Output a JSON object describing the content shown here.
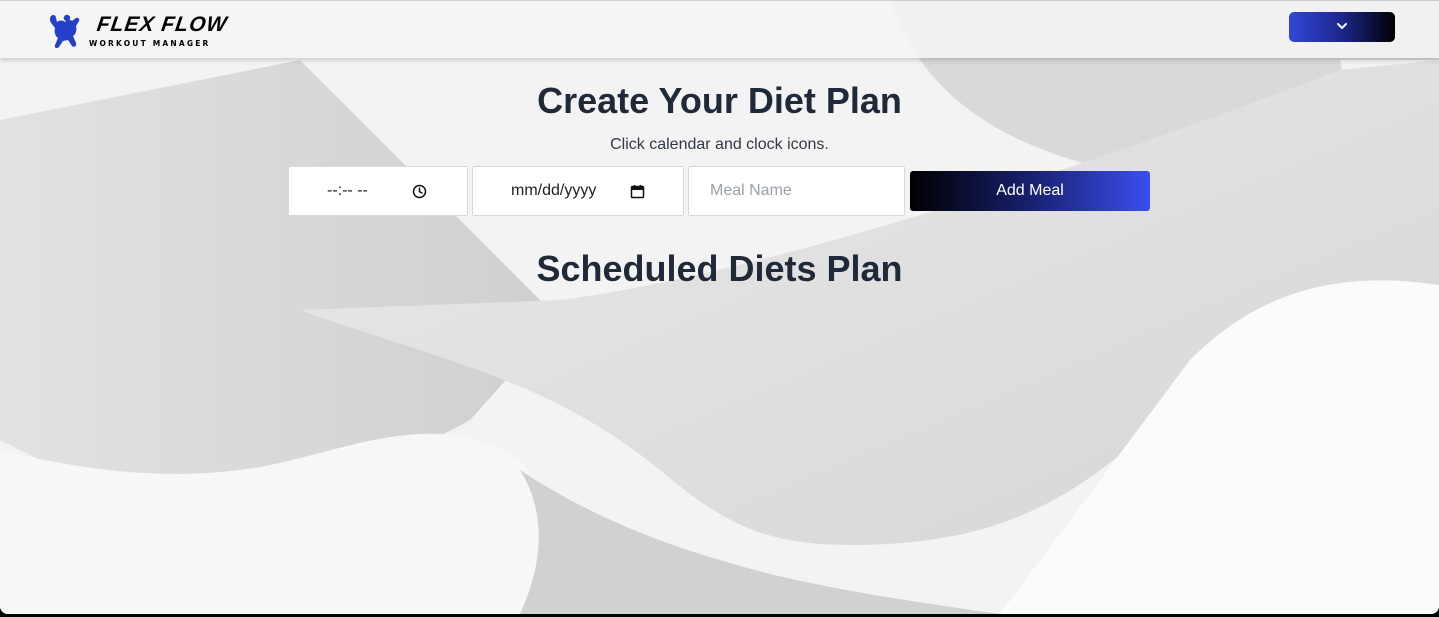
{
  "navbar": {
    "logo_title": "FLEX FLOW",
    "logo_subtitle": "WORKOUT MANAGER",
    "logo_icon": "bodybuilder-icon",
    "menu_icon": "chevron-down-icon"
  },
  "form": {
    "title": "Create Your Diet Plan",
    "hint": "Click calendar and clock icons.",
    "time_value": "--:-- --",
    "time_icon": "clock-icon",
    "date_value": "mm/dd/yyyy",
    "date_icon": "calendar-icon",
    "meal_name_placeholder": "Meal Name",
    "meal_name_value": "",
    "add_button_label": "Add Meal"
  },
  "scheduled": {
    "title": "Scheduled Diets Plan",
    "items": []
  },
  "colors": {
    "heading": "#1f2937",
    "accent_blue": "#3a4ef0",
    "accent_dark": "#000000"
  }
}
